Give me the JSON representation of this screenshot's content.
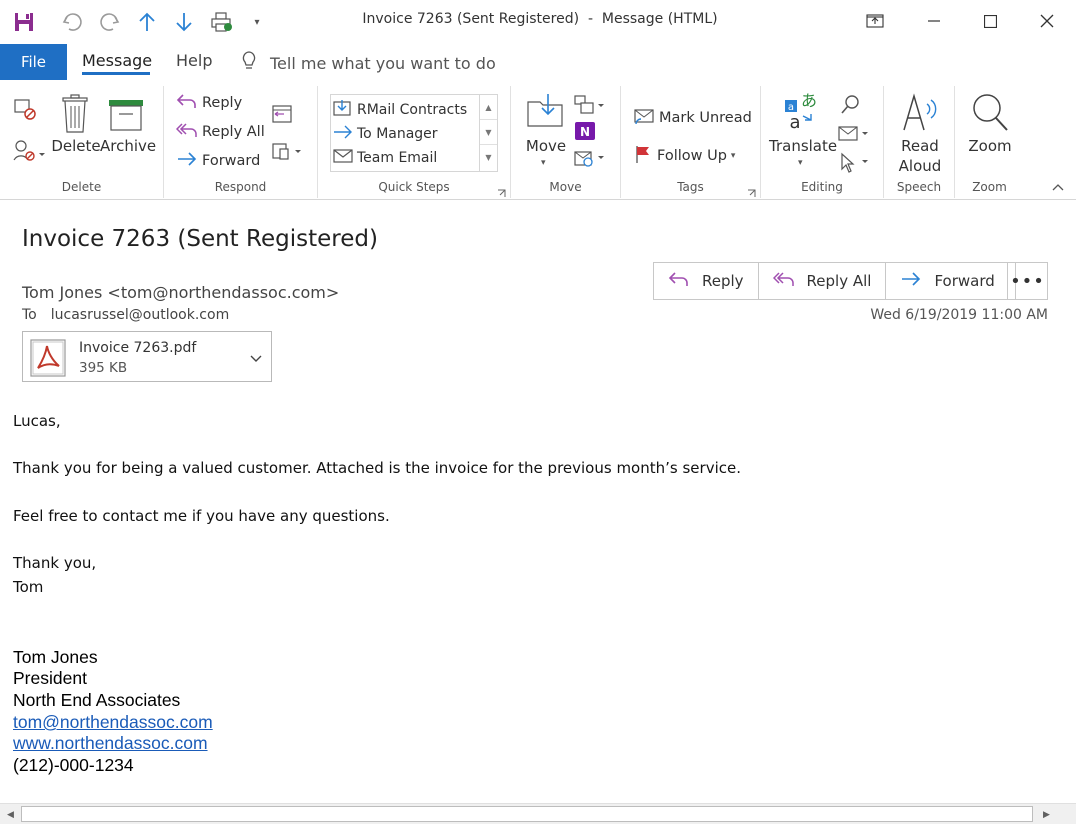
{
  "window": {
    "title": "Invoice 7263 (Sent Registered)  -  Message (HTML)"
  },
  "tabs": {
    "file": "File",
    "message": "Message",
    "help": "Help",
    "tell_me": "Tell me what you want to do"
  },
  "ribbon": {
    "delete_group": {
      "label": "Delete",
      "delete": "Delete",
      "archive": "Archive"
    },
    "respond_group": {
      "label": "Respond",
      "reply": "Reply",
      "reply_all": "Reply All",
      "forward": "Forward"
    },
    "quick_steps_group": {
      "label": "Quick Steps",
      "items": [
        "RMail Contracts",
        "To Manager",
        "Team Email"
      ]
    },
    "move_group": {
      "label": "Move",
      "move": "Move"
    },
    "tags_group": {
      "label": "Tags",
      "mark_unread": "Mark Unread",
      "follow_up": "Follow Up"
    },
    "editing_group": {
      "label": "Editing",
      "translate": "Translate"
    },
    "speech_group": {
      "label": "Speech",
      "read": "Read",
      "aloud": "Aloud"
    },
    "zoom_group": {
      "label": "Zoom",
      "zoom": "Zoom"
    }
  },
  "message": {
    "subject": "Invoice 7263 (Sent Registered)",
    "sender": "Tom Jones <tom@northendassoc.com>",
    "to_label": "To",
    "to": "lucasrussel@outlook.com",
    "date": "Wed 6/19/2019 11:00 AM",
    "actions": {
      "reply": "Reply",
      "reply_all": "Reply All",
      "forward": "Forward"
    },
    "attachment": {
      "name": "Invoice 7263.pdf",
      "size": "395 KB"
    },
    "body": {
      "greeting": "Lucas,",
      "line1": "Thank you for being a valued customer.  Attached is the invoice for the previous month’s service.",
      "line2": "Feel free to contact me if you have any questions.",
      "closing": "Thank you,",
      "name": "Tom"
    },
    "signature": {
      "name": "Tom Jones",
      "title": "President",
      "company": "North End Associates",
      "email": "tom@northendassoc.com",
      "website": "www.northendassoc.com",
      "phone": "(212)-000-1234"
    }
  },
  "colors": {
    "accent": "#1f6fc4",
    "reply_icon": "#a04fb0",
    "forward_icon": "#2b82d4",
    "link": "#1a5bb8"
  }
}
